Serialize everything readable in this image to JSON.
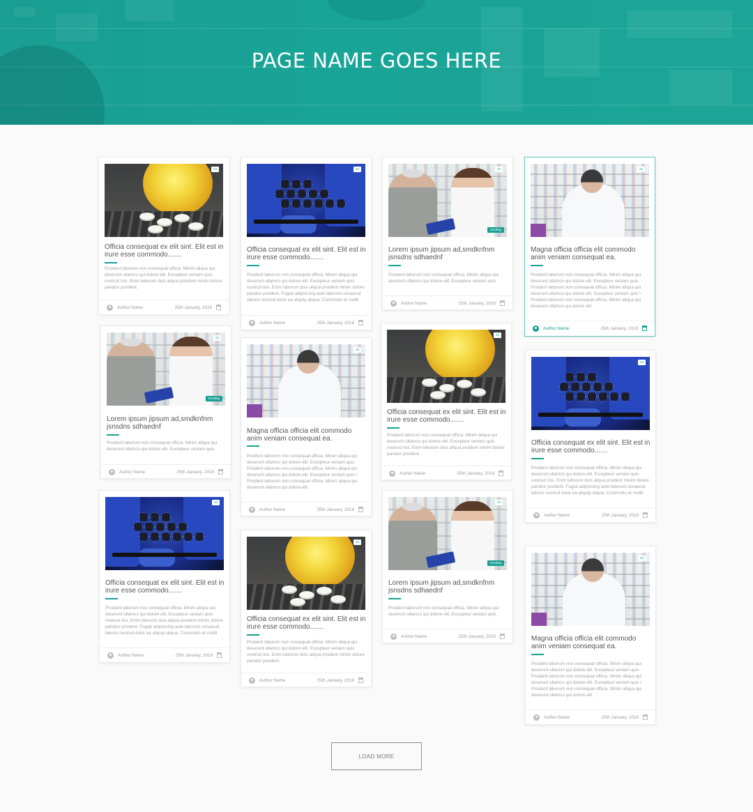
{
  "hero": {
    "title": "PAGE NAME GOES HERE"
  },
  "texts": {
    "title_a": "Officia consequat ex elit sint. Elit est in irure esse commodo.......",
    "title_b": "Lorem ipsum jipsum ad,smdknfnm jsnsdns sdhaednf",
    "title_c": "Magna officia officia elit commodo anim veniam consequat ea.",
    "body_a_short": "Proident laborum non consequat officia. Minim aliqua qui deserunt ullamco qui dolore elit. Excepteur veniam quis nostrud nisi. Enim laborum duis aliqua proident minim dolore pariatur proident.",
    "body_a_long": "Proident laborum non consequat officia. Minim aliqua qui deserunt ullamco qui dolore elit. Excepteur veniam quis nostrud nisi. Enim laborum duis aliqua proident minim dolore pariatur proident. Fugiat adipisicing aute laborum occaecat laboris nostrud dolor ea aliquip aliqua. Commodo et mollit",
    "body_b": "Proident laborum non consequat officia. Minim aliqua qui deserunt ullamco qui dolore elit. Excepteur veniam quis",
    "body_c": "Proident laborum non consequat officia. Minim aliqua qui deserunt ullamco qui dolore elit. Excepteur veniam quis Proident laborum non consequat officia. Minim aliqua qui deserunt ullamco qui dolore elit. Excepteur veniam quis \\. Proident laborum non consequat officia. Minim aliqua qui deserunt ullamco qui dolore elit."
  },
  "meta": {
    "author": "Author Name",
    "date": "25th January, 2018",
    "views": "23",
    "trending": "trending"
  },
  "load_more": "LOAD MORE",
  "colors": {
    "accent": "#17a091",
    "hero": "#1a9e92"
  }
}
